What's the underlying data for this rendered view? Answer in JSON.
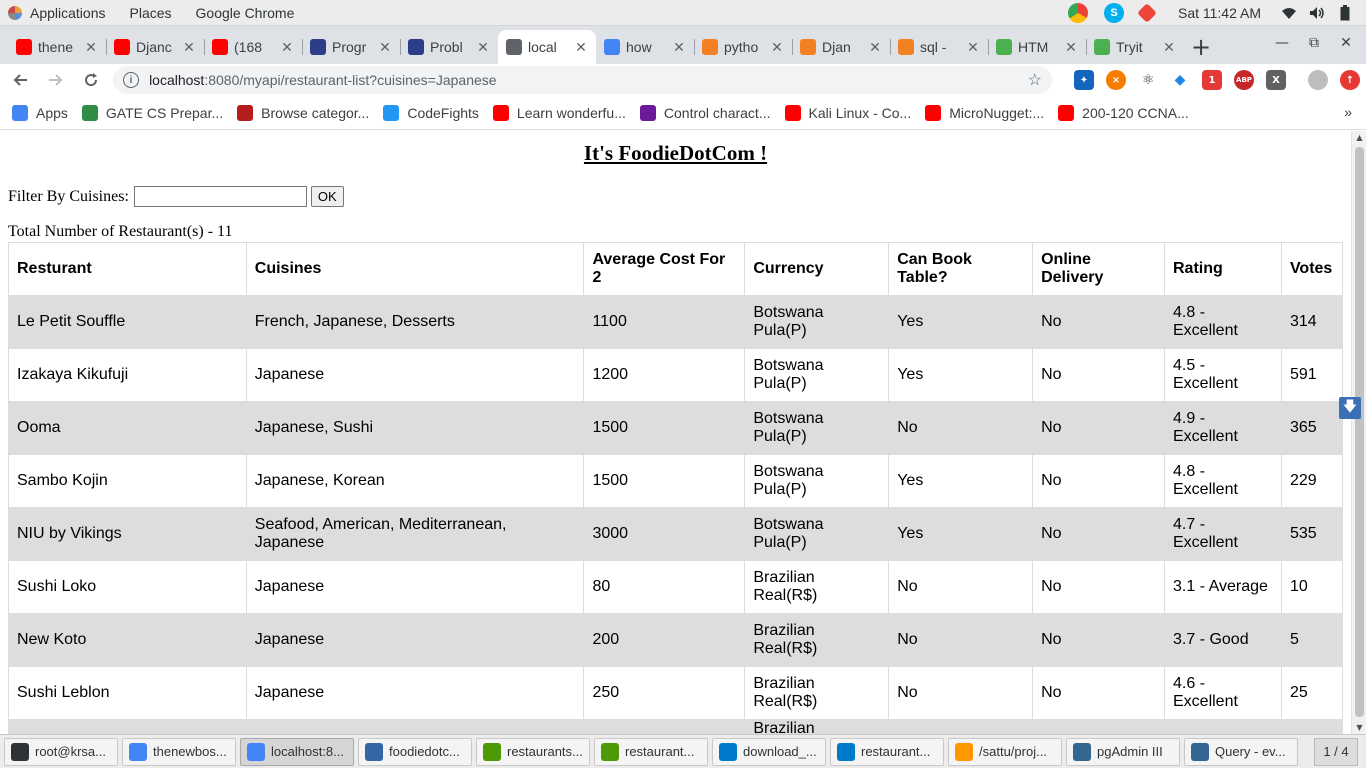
{
  "topbar": {
    "applications": "Applications",
    "places": "Places",
    "app_name": "Google Chrome",
    "clock": "Sat 11:42 AM"
  },
  "tabs": [
    {
      "title": "thene",
      "icon": "youtube-icon",
      "color": "#ff0000"
    },
    {
      "title": "Djanc",
      "icon": "youtube-icon",
      "color": "#ff0000"
    },
    {
      "title": "(168",
      "icon": "youtube-icon",
      "color": "#ff0000"
    },
    {
      "title": "Progr",
      "icon": "document-icon",
      "color": "#2c3e8a"
    },
    {
      "title": "Probl",
      "icon": "document-icon",
      "color": "#2c3e8a"
    },
    {
      "title": "local",
      "icon": "globe-icon",
      "color": "#5f6368",
      "active": true
    },
    {
      "title": "how",
      "icon": "google-icon",
      "color": "#4285f4"
    },
    {
      "title": "pytho",
      "icon": "stackoverflow-icon",
      "color": "#f48024"
    },
    {
      "title": "Djan",
      "icon": "stackoverflow-icon",
      "color": "#f48024"
    },
    {
      "title": "sql -",
      "icon": "stackoverflow-icon",
      "color": "#f48024"
    },
    {
      "title": "HTM",
      "icon": "w3-icon",
      "color": "#4caf50"
    },
    {
      "title": "Tryit",
      "icon": "w3-icon",
      "color": "#4caf50"
    }
  ],
  "omnibox": {
    "host": "localhost",
    "path": ":8080/myapi/restaurant-list?cuisines=Japanese"
  },
  "bookmarks": [
    {
      "label": "Apps",
      "icon": "apps-grid-icon",
      "color": "#4285f4"
    },
    {
      "label": "GATE CS Prepar...",
      "icon": "gfg-icon",
      "color": "#2f8d46"
    },
    {
      "label": "Browse categor...",
      "icon": "question-icon",
      "color": "#b71c1c"
    },
    {
      "label": "CodeFights",
      "icon": "codefights-icon",
      "color": "#2196f3"
    },
    {
      "label": "Learn wonderfu...",
      "icon": "youtube-icon",
      "color": "#ff0000"
    },
    {
      "label": "Control charact...",
      "icon": "ut-icon",
      "color": "#6a1b9a"
    },
    {
      "label": "Kali Linux - Co...",
      "icon": "youtube-icon",
      "color": "#ff0000"
    },
    {
      "label": "MicroNugget:...",
      "icon": "youtube-icon",
      "color": "#ff0000"
    },
    {
      "label": "200-120 CCNA...",
      "icon": "youtube-icon",
      "color": "#ff0000"
    }
  ],
  "page": {
    "title": "It's FoodieDotCom !",
    "filter_label": "Filter By Cuisines:",
    "filter_value": "",
    "ok_label": "OK",
    "total": "Total Number of Restaurant(s) - 11"
  },
  "table": {
    "headers": [
      "Resturant",
      "Cuisines",
      "Average Cost For 2",
      "Currency",
      "Can Book Table?",
      "Online Delivery",
      "Rating",
      "Votes"
    ],
    "rows": [
      [
        "Le Petit Souffle",
        "French, Japanese, Desserts",
        "1100",
        "Botswana Pula(P)",
        "Yes",
        "No",
        "4.8 - Excellent",
        "314"
      ],
      [
        "Izakaya Kikufuji",
        "Japanese",
        "1200",
        "Botswana Pula(P)",
        "Yes",
        "No",
        "4.5 - Excellent",
        "591"
      ],
      [
        "Ooma",
        "Japanese, Sushi",
        "1500",
        "Botswana Pula(P)",
        "No",
        "No",
        "4.9 - Excellent",
        "365"
      ],
      [
        "Sambo Kojin",
        "Japanese, Korean",
        "1500",
        "Botswana Pula(P)",
        "Yes",
        "No",
        "4.8 - Excellent",
        "229"
      ],
      [
        "NIU by Vikings",
        "Seafood, American, Mediterranean, Japanese",
        "3000",
        "Botswana Pula(P)",
        "Yes",
        "No",
        "4.7 - Excellent",
        "535"
      ],
      [
        "Sushi Loko",
        "Japanese",
        "80",
        "Brazilian Real(R$)",
        "No",
        "No",
        "3.1 - Average",
        "10"
      ],
      [
        "New Koto",
        "Japanese",
        "200",
        "Brazilian Real(R$)",
        "No",
        "No",
        "3.7 - Good",
        "5"
      ],
      [
        "Sushi Leblon",
        "Japanese",
        "250",
        "Brazilian Real(R$)",
        "No",
        "No",
        "4.6 - Excellent",
        "25"
      ],
      [
        "",
        "",
        "",
        "Brazilian",
        "",
        "",
        "",
        ""
      ]
    ]
  },
  "taskbar": [
    {
      "label": "root@krsa...",
      "icon": "terminal-icon",
      "color": "#2e3436"
    },
    {
      "label": "thenewbos...",
      "icon": "chrome-icon",
      "color": "#4285f4"
    },
    {
      "label": "localhost:8...",
      "icon": "chrome-icon",
      "color": "#4285f4",
      "active": true
    },
    {
      "label": "foodiedotc...",
      "icon": "file-manager-icon",
      "color": "#3465a4"
    },
    {
      "label": "restaurants...",
      "icon": "spreadsheet-icon",
      "color": "#4e9a06"
    },
    {
      "label": "restaurant...",
      "icon": "spreadsheet-icon",
      "color": "#4e9a06"
    },
    {
      "label": "download_...",
      "icon": "vscode-icon",
      "color": "#007acc"
    },
    {
      "label": "restaurant...",
      "icon": "vscode-icon",
      "color": "#007acc"
    },
    {
      "label": "/sattu/proj...",
      "icon": "sublime-icon",
      "color": "#ff9800"
    },
    {
      "label": "pgAdmin III",
      "icon": "pgadmin-icon",
      "color": "#336791"
    },
    {
      "label": "Query - ev...",
      "icon": "pgadmin-icon",
      "color": "#336791"
    }
  ],
  "workspace": "1 / 4"
}
